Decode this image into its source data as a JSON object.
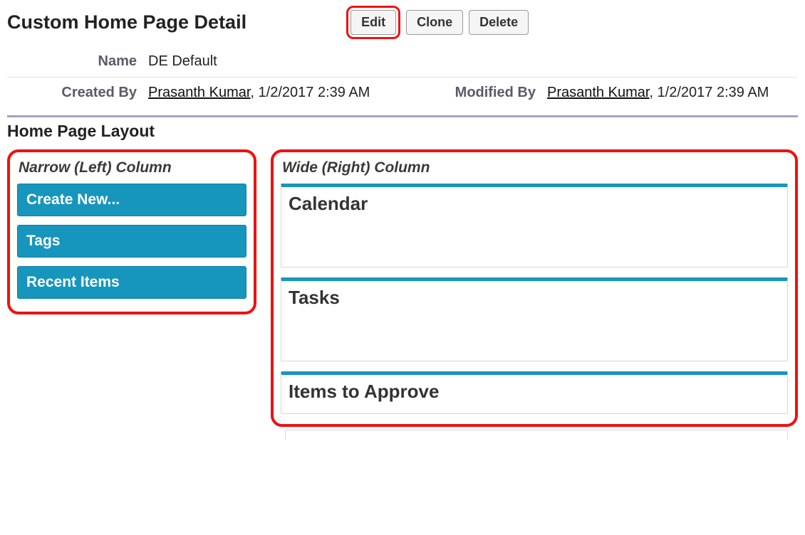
{
  "header": {
    "title": "Custom Home Page Detail",
    "buttons": {
      "edit": "Edit",
      "clone": "Clone",
      "delete": "Delete"
    }
  },
  "detail": {
    "name_label": "Name",
    "name_value": "DE Default",
    "created_by_label": "Created By",
    "created_by_user": "Prasanth Kumar",
    "created_by_date": ", 1/2/2017 2:39 AM",
    "modified_by_label": "Modified By",
    "modified_by_user": "Prasanth Kumar",
    "modified_by_date": ", 1/2/2017 2:39 AM"
  },
  "layout": {
    "section_title": "Home Page Layout",
    "narrow": {
      "title": "Narrow (Left) Column",
      "items": [
        "Create New...",
        "Tags",
        "Recent Items"
      ]
    },
    "wide": {
      "title": "Wide (Right) Column",
      "items": [
        "Calendar",
        "Tasks",
        "Items to Approve"
      ]
    }
  }
}
